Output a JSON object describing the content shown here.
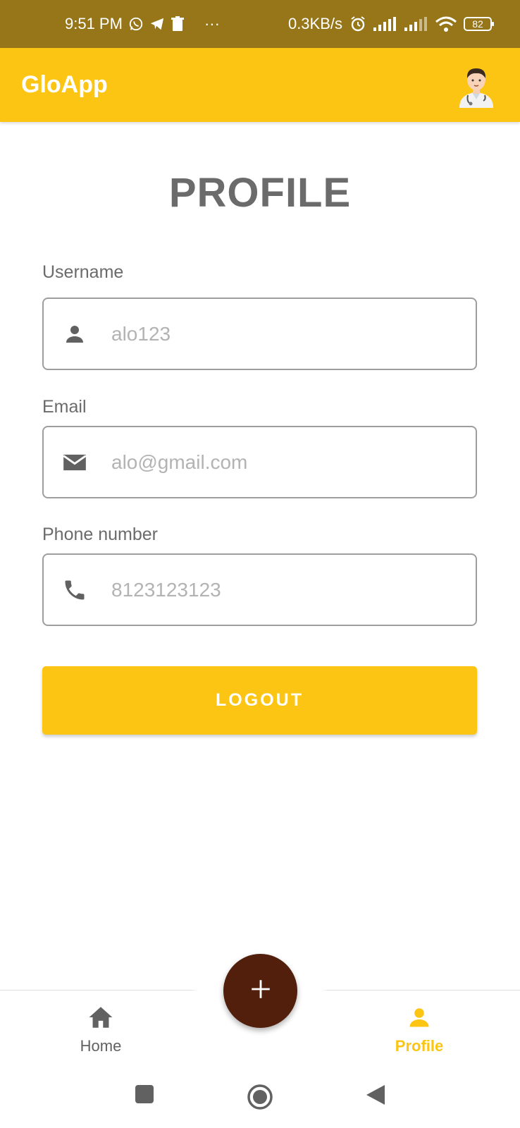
{
  "status_bar": {
    "time": "9:51 PM",
    "more": "···",
    "net_speed": "0.3KB/s",
    "battery": "82",
    "icons": [
      "whatsapp-icon",
      "telegram-icon",
      "trash-icon",
      "alarm-icon",
      "signal-icon",
      "signal-icon",
      "wifi-icon",
      "battery-icon"
    ]
  },
  "app_bar": {
    "title": "GloApp",
    "avatar_icon": "doctor-avatar-icon",
    "background": "#FDC513"
  },
  "page": {
    "title": "PROFILE"
  },
  "form": {
    "username": {
      "label": "Username",
      "value": "alo123",
      "icon": "person-icon"
    },
    "email": {
      "label": "Email",
      "value": "alo@gmail.com",
      "icon": "mail-icon"
    },
    "phone": {
      "label": "Phone number",
      "value": "8123123123",
      "icon": "phone-icon"
    }
  },
  "logout": {
    "label": "LOGOUT"
  },
  "fab": {
    "icon": "plus-icon",
    "color": "#521F0C"
  },
  "bottom_nav": {
    "items": [
      {
        "label": "Home",
        "icon": "home-icon",
        "active": false
      },
      {
        "label": "Profile",
        "icon": "person-icon",
        "active": true
      }
    ],
    "active_color": "#FDC513"
  },
  "system_nav": {
    "icons": [
      "square-icon",
      "circle-icon",
      "back-triangle-icon"
    ]
  }
}
